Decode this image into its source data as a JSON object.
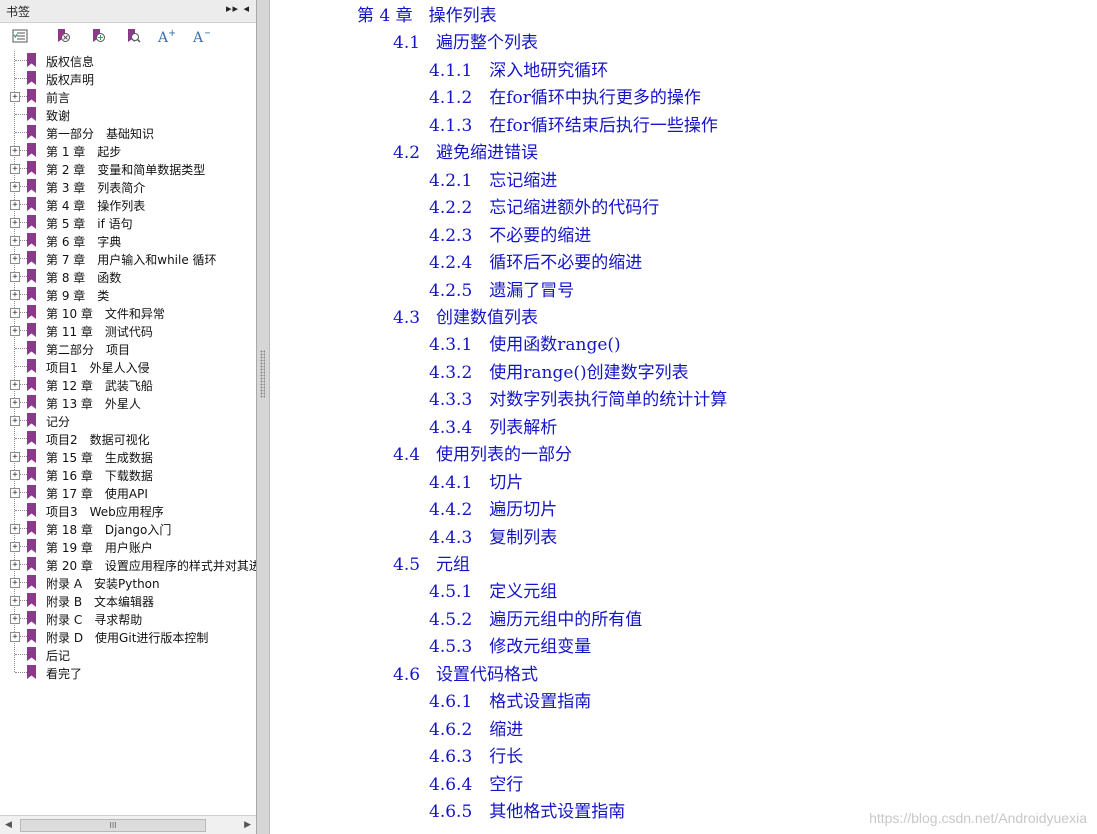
{
  "panel": {
    "title": "书签",
    "controls": "▸▸ ◂",
    "toolbar": [
      {
        "name": "bookmark-options-icon",
        "glyph": "☰"
      },
      {
        "name": "bookmark-delete-icon",
        "glyph": "⊗"
      },
      {
        "name": "bookmark-new-icon",
        "glyph": "⊕"
      },
      {
        "name": "bookmark-find-icon",
        "glyph": "⊙"
      },
      {
        "name": "increase-text-size-icon",
        "glyph": "A+"
      },
      {
        "name": "decrease-text-size-icon",
        "glyph": "A−"
      }
    ],
    "bookmarks": [
      {
        "label": "版权信息",
        "expandable": false
      },
      {
        "label": "版权声明",
        "expandable": false
      },
      {
        "label": "前言",
        "expandable": true
      },
      {
        "label": "致谢",
        "expandable": false
      },
      {
        "label": "第一部分　基础知识",
        "expandable": false
      },
      {
        "label": "第 1 章　起步",
        "expandable": true
      },
      {
        "label": "第 2 章　变量和简单数据类型",
        "expandable": true
      },
      {
        "label": "第 3 章　列表简介",
        "expandable": true
      },
      {
        "label": "第 4 章　操作列表",
        "expandable": true
      },
      {
        "label": "第 5 章　if 语句",
        "expandable": true
      },
      {
        "label": "第 6 章　字典",
        "expandable": true
      },
      {
        "label": "第 7 章　用户输入和while 循环",
        "expandable": true
      },
      {
        "label": "第 8 章　函数",
        "expandable": true
      },
      {
        "label": "第 9 章　类",
        "expandable": true
      },
      {
        "label": "第 10 章　文件和异常",
        "expandable": true
      },
      {
        "label": "第 11 章　测试代码",
        "expandable": true
      },
      {
        "label": "第二部分　项目",
        "expandable": false
      },
      {
        "label": "项目1　外星人入侵",
        "expandable": false
      },
      {
        "label": "第 12 章　武装飞船",
        "expandable": true
      },
      {
        "label": "第 13 章　外星人",
        "expandable": true
      },
      {
        "label": "记分",
        "expandable": true
      },
      {
        "label": "项目2　数据可视化",
        "expandable": false
      },
      {
        "label": "第 15 章　生成数据",
        "expandable": true
      },
      {
        "label": "第 16 章　下载数据",
        "expandable": true
      },
      {
        "label": "第 17 章　使用API",
        "expandable": true
      },
      {
        "label": "项目3　Web应用程序",
        "expandable": false
      },
      {
        "label": "第 18 章　Django入门",
        "expandable": true
      },
      {
        "label": "第 19 章　用户账户",
        "expandable": true
      },
      {
        "label": "第 20 章　设置应用程序的样式并对其进",
        "expandable": true
      },
      {
        "label": "附录 A　安装Python",
        "expandable": true
      },
      {
        "label": "附录 B　文本编辑器",
        "expandable": true
      },
      {
        "label": "附录 C　寻求帮助",
        "expandable": true
      },
      {
        "label": "附录 D　使用Git进行版本控制",
        "expandable": true
      },
      {
        "label": "后记",
        "expandable": false
      },
      {
        "label": "看完了",
        "expandable": false
      }
    ],
    "scroll_thumb_label": "III"
  },
  "colors": {
    "link": "#1414c8",
    "bookmark_icon": "#8b3a8b"
  },
  "toc": [
    {
      "level": 0,
      "num": "第 4 章",
      "title": "操作列表"
    },
    {
      "level": 1,
      "num": "4.1",
      "title": "遍历整个列表"
    },
    {
      "level": 2,
      "num": "4.1.1",
      "title": "深入地研究循环"
    },
    {
      "level": 2,
      "num": "4.1.2",
      "title": "在for循环中执行更多的操作"
    },
    {
      "level": 2,
      "num": "4.1.3",
      "title": "在for循环结束后执行一些操作"
    },
    {
      "level": 1,
      "num": "4.2",
      "title": "避免缩进错误"
    },
    {
      "level": 2,
      "num": "4.2.1",
      "title": "忘记缩进"
    },
    {
      "level": 2,
      "num": "4.2.2",
      "title": "忘记缩进额外的代码行"
    },
    {
      "level": 2,
      "num": "4.2.3",
      "title": "不必要的缩进"
    },
    {
      "level": 2,
      "num": "4.2.4",
      "title": "循环后不必要的缩进"
    },
    {
      "level": 2,
      "num": "4.2.5",
      "title": "遗漏了冒号"
    },
    {
      "level": 1,
      "num": "4.3",
      "title": "创建数值列表"
    },
    {
      "level": 2,
      "num": "4.3.1",
      "title": "使用函数range()"
    },
    {
      "level": 2,
      "num": "4.3.2",
      "title": "使用range()创建数字列表"
    },
    {
      "level": 2,
      "num": "4.3.3",
      "title": "对数字列表执行简单的统计计算"
    },
    {
      "level": 2,
      "num": "4.3.4",
      "title": "列表解析"
    },
    {
      "level": 1,
      "num": "4.4",
      "title": "使用列表的一部分"
    },
    {
      "level": 2,
      "num": "4.4.1",
      "title": "切片"
    },
    {
      "level": 2,
      "num": "4.4.2",
      "title": "遍历切片"
    },
    {
      "level": 2,
      "num": "4.4.3",
      "title": "复制列表"
    },
    {
      "level": 1,
      "num": "4.5",
      "title": "元组"
    },
    {
      "level": 2,
      "num": "4.5.1",
      "title": "定义元组"
    },
    {
      "level": 2,
      "num": "4.5.2",
      "title": "遍历元组中的所有值"
    },
    {
      "level": 2,
      "num": "4.5.3",
      "title": "修改元组变量"
    },
    {
      "level": 1,
      "num": "4.6",
      "title": "设置代码格式"
    },
    {
      "level": 2,
      "num": "4.6.1",
      "title": "格式设置指南"
    },
    {
      "level": 2,
      "num": "4.6.2",
      "title": "缩进"
    },
    {
      "level": 2,
      "num": "4.6.3",
      "title": "行长"
    },
    {
      "level": 2,
      "num": "4.6.4",
      "title": "空行"
    },
    {
      "level": 2,
      "num": "4.6.5",
      "title": "其他格式设置指南"
    }
  ],
  "watermark": "https://blog.csdn.net/Androidyuexia"
}
